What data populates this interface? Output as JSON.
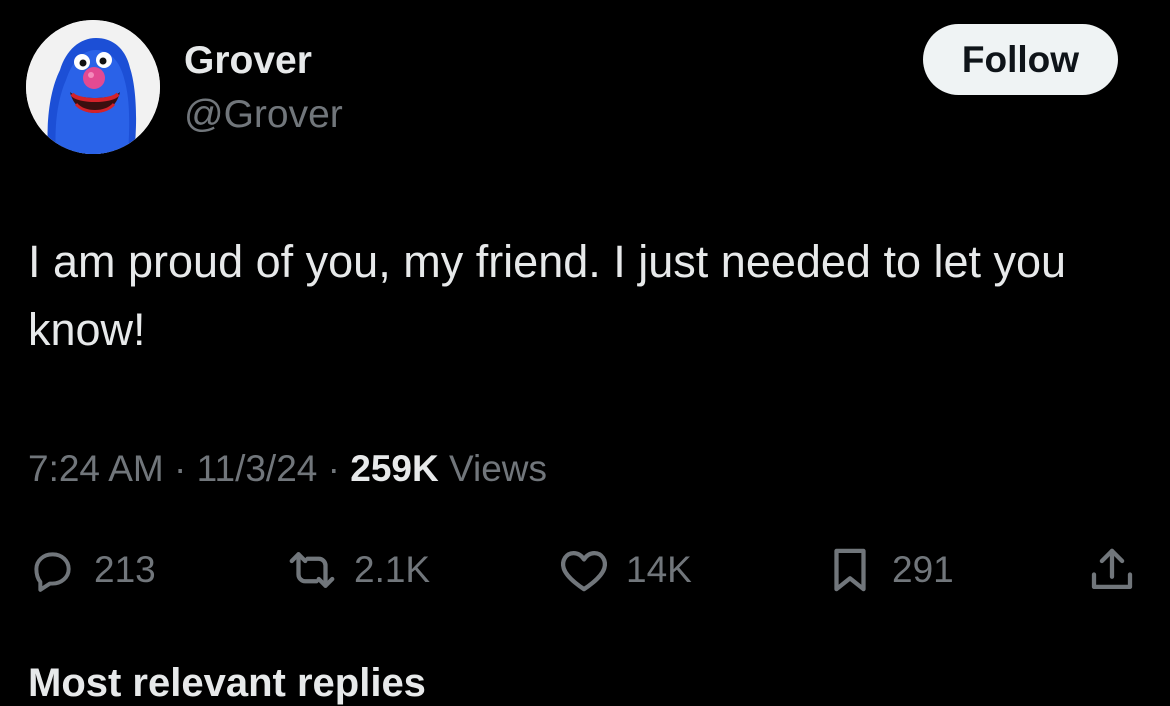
{
  "author": {
    "display_name": "Grover",
    "handle": "@Grover",
    "avatar_icon": "grover-avatar-icon"
  },
  "follow_button": {
    "label": "Follow"
  },
  "tweet": {
    "text": "I am proud of you, my friend. I just needed to let you know!",
    "time": "7:24 AM",
    "date": "11/3/24",
    "separator": "·",
    "views_count": "259K",
    "views_label": "Views"
  },
  "actions": {
    "replies": {
      "icon": "reply-icon",
      "count": "213"
    },
    "reposts": {
      "icon": "repost-icon",
      "count": "2.1K"
    },
    "likes": {
      "icon": "heart-icon",
      "count": "14K"
    },
    "bookmarks": {
      "icon": "bookmark-icon",
      "count": "291"
    },
    "share": {
      "icon": "share-icon"
    }
  },
  "next_section": {
    "title": "Most relevant replies"
  },
  "colors": {
    "background": "#000000",
    "primary_text": "#e7e9ea",
    "secondary_text": "#71767b",
    "follow_bg": "#eff3f4"
  }
}
